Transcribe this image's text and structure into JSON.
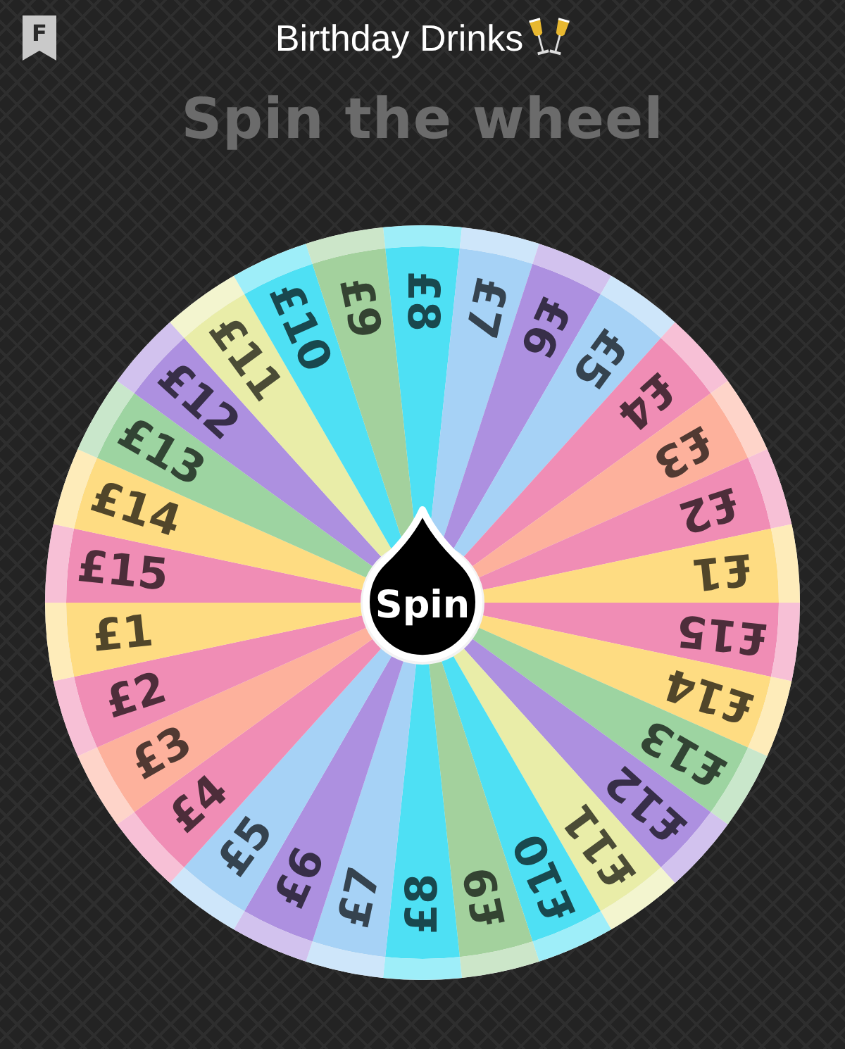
{
  "header": {
    "badge": "F",
    "title": "Birthday Drinks"
  },
  "heading": "Spin the wheel",
  "wheel": {
    "segments": [
      {
        "label": "£8",
        "color": "#4ee0f4"
      },
      {
        "label": "£7",
        "color": "#a6d2f6"
      },
      {
        "label": "£6",
        "color": "#ad90e0"
      },
      {
        "label": "£5",
        "color": "#a6d2f6"
      },
      {
        "label": "£4",
        "color": "#f08db5"
      },
      {
        "label": "£3",
        "color": "#fdb19c"
      },
      {
        "label": "£2",
        "color": "#f08db5"
      },
      {
        "label": "£1",
        "color": "#fedc82"
      },
      {
        "label": "£15",
        "color": "#f08db5"
      },
      {
        "label": "£14",
        "color": "#fedc82"
      },
      {
        "label": "£13",
        "color": "#9dd4a1"
      },
      {
        "label": "£12",
        "color": "#ad90e0"
      },
      {
        "label": "£11",
        "color": "#e9eda8"
      },
      {
        "label": "£10",
        "color": "#4ee0f4"
      },
      {
        "label": "£9",
        "color": "#a3d19d"
      },
      {
        "label": "£8",
        "color": "#4ee0f4"
      },
      {
        "label": "£7",
        "color": "#a6d2f6"
      },
      {
        "label": "£6",
        "color": "#ad90e0"
      },
      {
        "label": "£5",
        "color": "#a6d2f6"
      },
      {
        "label": "£4",
        "color": "#f08db5"
      },
      {
        "label": "£3",
        "color": "#fdb19c"
      },
      {
        "label": "£2",
        "color": "#f08db5"
      },
      {
        "label": "£1",
        "color": "#fedc82"
      },
      {
        "label": "£15",
        "color": "#f08db5"
      },
      {
        "label": "£14",
        "color": "#fedc82"
      },
      {
        "label": "£13",
        "color": "#9dd4a1"
      },
      {
        "label": "£12",
        "color": "#ad90e0"
      },
      {
        "label": "£11",
        "color": "#e9eda8"
      },
      {
        "label": "£10",
        "color": "#4ee0f4"
      },
      {
        "label": "£9",
        "color": "#a3d19d"
      }
    ]
  },
  "spin_button": "Spin"
}
